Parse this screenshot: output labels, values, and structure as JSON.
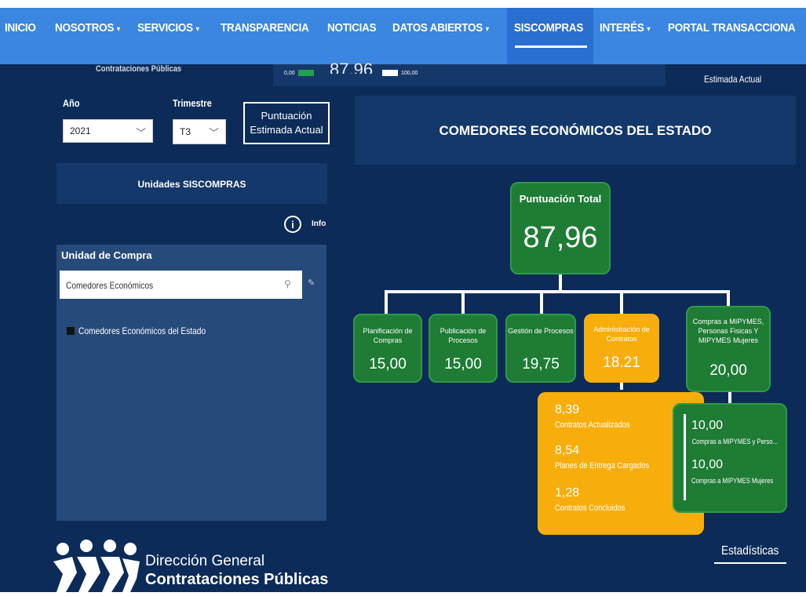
{
  "nav": {
    "items": [
      {
        "label": "INICIO",
        "caret": false
      },
      {
        "label": "NOSOTROS",
        "caret": true
      },
      {
        "label": "SERVICIOS",
        "caret": true
      },
      {
        "label": "TRANSPARENCIA",
        "caret": false
      },
      {
        "label": "NOTICIAS",
        "caret": false
      },
      {
        "label": "DATOS ABIERTOS",
        "caret": true
      },
      {
        "label": "SISCOMPRAS",
        "caret": false,
        "active": true
      },
      {
        "label": "INTERÉS",
        "caret": true
      },
      {
        "label": "PORTAL TRANSACCIONA",
        "caret": false
      }
    ],
    "caret_glyph": "▾"
  },
  "header_strip": {
    "left_title": "Contrataciones Públicas",
    "legend_min": "0,00",
    "legend_value": "87,96",
    "legend_max": "100,00",
    "right_label": "Estimada Actual"
  },
  "filters": {
    "year_label": "Año",
    "year_value": "2021",
    "quarter_label": "Trimestre",
    "quarter_value": "T3",
    "score_button": "Puntuación Estimada Actual",
    "units_button": "Unidades SISCOMPRAS",
    "info_label": "Info"
  },
  "unit_panel": {
    "title": "Unidad de Compra",
    "search_value": "Comedores Económicos",
    "items": [
      "Comedores Económicos del Estado"
    ]
  },
  "main": {
    "title": "COMEDORES ECONÓMICOS DEL ESTADO",
    "total_label": "Puntuación Total",
    "total_value": "87,96",
    "pillars": [
      {
        "label": "Planificación de Compras",
        "value": "15,00",
        "color": "#1e7c34"
      },
      {
        "label": "Publicación de Procesos",
        "value": "15,00",
        "color": "#1e7c34"
      },
      {
        "label": "Gestión de Procesos",
        "value": "19,75",
        "color": "#1e7c34"
      },
      {
        "label": "Administración de Contratos",
        "value": "18.21",
        "color": "#f7ae0c"
      },
      {
        "label": "Compras a MIPYMES, Personas Fisicas Y MIPYMES Mujeres",
        "value": "20,00",
        "color": "#1e7c34"
      }
    ],
    "admin_details": [
      {
        "value": "8,39",
        "label": "Contratos Actualizados"
      },
      {
        "value": "8,54",
        "label": "Planes de Entrega Cargados"
      },
      {
        "value": "1,28",
        "label": "Contratos Concluidos"
      }
    ],
    "mipymes_details": [
      {
        "value": "10,00",
        "label": "Compras a MIPYMES y Perso..."
      },
      {
        "value": "10,00",
        "label": "Compras a MIPYMES Mujeres"
      }
    ]
  },
  "footer": {
    "logo_line1": "Dirección General",
    "logo_line2": "Contrataciones Públicas",
    "stats_link": "Estadísticas"
  },
  "colors": {
    "nav": "#3a86e0",
    "canvas": "#0c2b58",
    "panel": "#15386a",
    "green": "#1e7c34",
    "amber": "#f7ae0c"
  }
}
